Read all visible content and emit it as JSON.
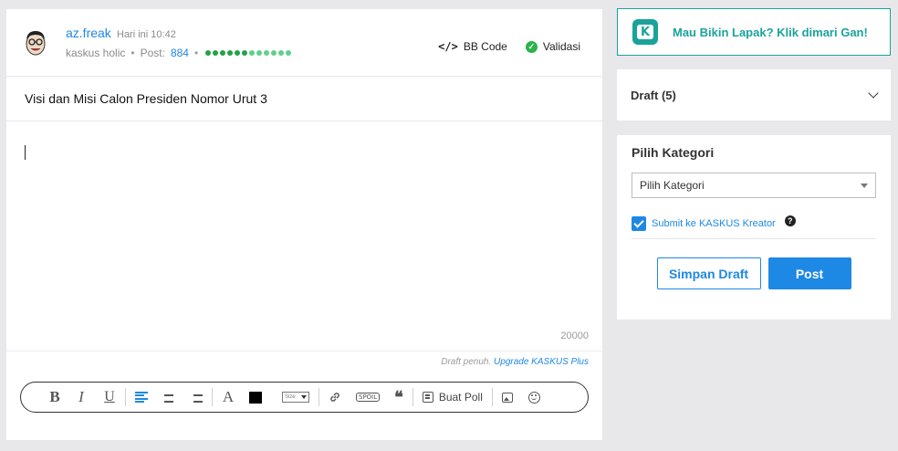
{
  "user": {
    "name": "az.freak",
    "time": "Hari ini 10:42",
    "rank": "kaskus holic",
    "post_label": "Post:",
    "post_count": "884",
    "reputation_dots": 12
  },
  "header_tools": {
    "bbcode_label": "BB Code",
    "validasi_label": "Validasi"
  },
  "thread": {
    "title": "Visi dan Misi Calon Presiden Nomor Urut 3",
    "body": "",
    "char_limit": "20000"
  },
  "draft_note": {
    "text": "Draft penuh.",
    "link": "Upgrade KASKUS Plus"
  },
  "toolbar": {
    "bold": "B",
    "italic": "I",
    "underline": "U",
    "font": "A",
    "size_label": "Size",
    "spoiler_label": "SPOIL",
    "quote_label": "❝",
    "poll_label": "Buat Poll",
    "text_color": "#000000"
  },
  "lapak": {
    "text": "Mau Bikin Lapak? Klik dimari Gan!",
    "color": "#1aa39a"
  },
  "draft_panel": {
    "label": "Draft (5)"
  },
  "category": {
    "title": "Pilih Kategori",
    "selected": "Pilih Kategori",
    "kreator_label": "Submit ke KASKUS Kreator",
    "kreator_checked": true
  },
  "actions": {
    "save_draft": "Simpan Draft",
    "post": "Post"
  },
  "colors": {
    "accent": "#1e88e5",
    "success": "#2cb34a"
  }
}
